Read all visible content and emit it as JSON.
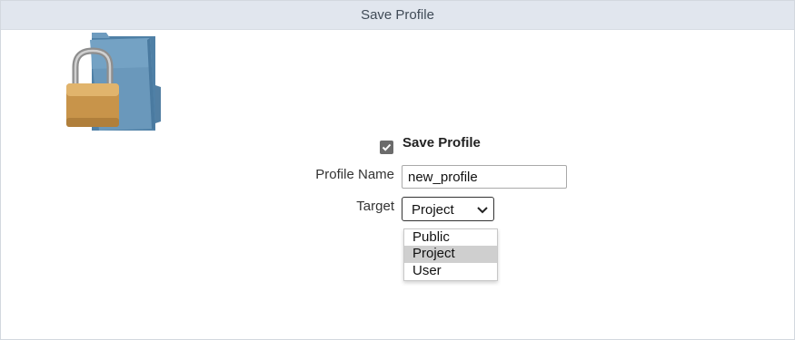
{
  "dialog": {
    "title": "Save Profile"
  },
  "icon": "locked-folder-icon",
  "form": {
    "save_profile": {
      "label": "Save Profile",
      "checked": true
    },
    "profile_name": {
      "label": "Profile Name",
      "value": "new_profile"
    },
    "target": {
      "label": "Target",
      "selected": "Project",
      "options": [
        "Public",
        "Project",
        "User"
      ]
    }
  },
  "colors": {
    "titlebar_bg": "#e1e6ee",
    "checkbox": "#6b6b6b",
    "option_highlight": "#cfcfcf",
    "folder_blue": "#5f90b4",
    "lock_gold": "#d9a75a"
  }
}
